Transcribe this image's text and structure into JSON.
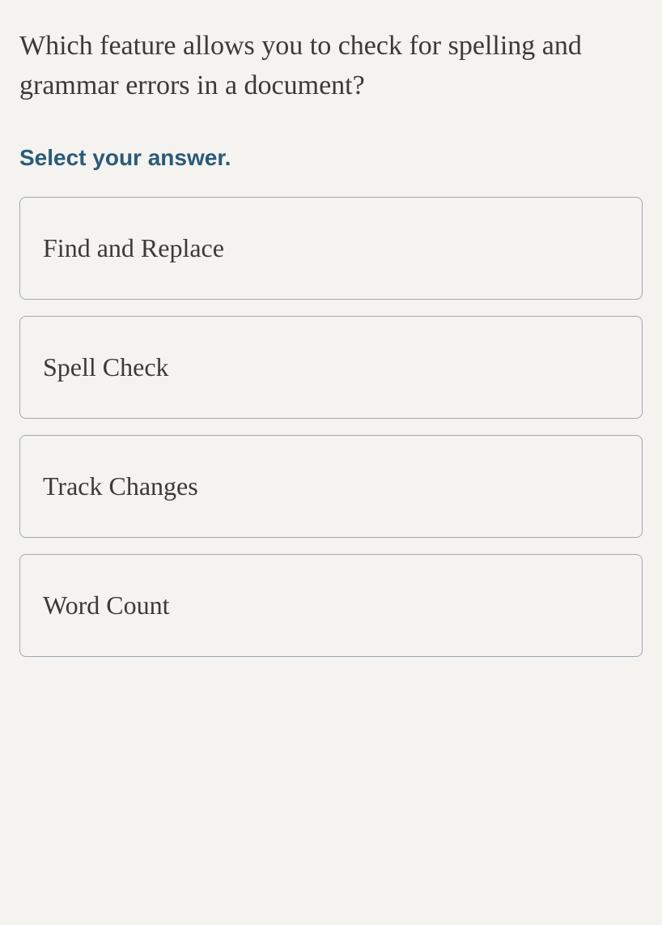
{
  "question": {
    "text": "Which feature allows you to check for spelling and grammar errors in a document?",
    "instruction": "Select your answer."
  },
  "options": [
    {
      "label": "Find and Replace"
    },
    {
      "label": "Spell Check"
    },
    {
      "label": "Track Changes"
    },
    {
      "label": "Word Count"
    }
  ]
}
